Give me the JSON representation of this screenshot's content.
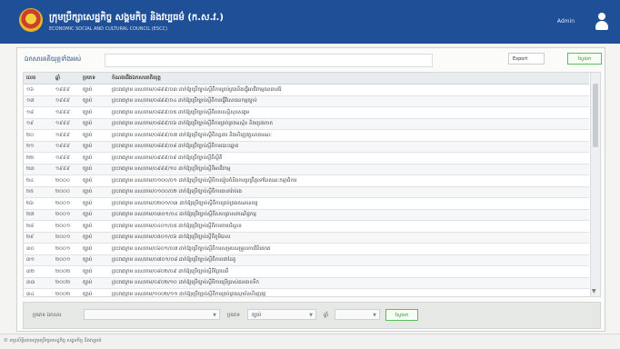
{
  "header": {
    "title": "ក្រុមប្រឹក្សាសេដ្ឋកិច្ច សង្គមកិច្ច និងវប្បធម៌ (ក.ស.វ.)",
    "subtitle": "ECONOMIC SOCIAL AND CULTURAL COUNCIL (ESCC)",
    "user_name": "Admin",
    "icons": {
      "logo": "escc-logo",
      "user": "user-icon"
    }
  },
  "panel": {
    "title": "ឯកសារគតិយុត្តទាំងអស់",
    "filter_placeholder": "",
    "export_label": "Export",
    "search_button": "ស្វែងរក"
  },
  "table": {
    "columns": [
      "លេខ",
      "ឆ្នាំ",
      "ប្រភេទ",
      "ចំណងជើងឯកសារគតិយុត្ត"
    ],
    "rows": [
      {
        "num": "១៦",
        "year": "១៩៩៩",
        "type": "ច្បាប់",
        "title": "ព្រះរាជក្រម នស/រកម/០៨៩៩/០៣ ដាក់ឱ្យប្រើច្បាប់ស្តីពីការគ្រប់គ្រងនិងធ្វើអាជីវកម្មធនធានរ៉ែ"
      },
      {
        "num": "១៧",
        "year": "១៩៩៩",
        "type": "ច្បាប់",
        "title": "ព្រះរាជក្រម នស/រកម/០៨៩៩/០៤ ដាក់ឱ្យប្រើច្បាប់ស្តីពីការធ្វើវិសោធនកម្មច្បាប់"
      },
      {
        "num": "១៨",
        "year": "១៩៩៩",
        "type": "ច្បាប់",
        "title": "ព្រះរាជក្រម នស/រកម/០៨៩៩/០៥ ដាក់ឱ្យប្រើច្បាប់ស្តីពីរបបសន្តិសុខសង្គម"
      },
      {
        "num": "១៩",
        "year": "១៩៩៩",
        "type": "ច្បាប់",
        "title": "ព្រះរាជក្រម នស/រកម/០៨៩៩/០៦ ដាក់ឱ្យប្រើច្បាប់ស្តីពីការគ្រប់គ្រងឧស្ម័ន និងប្រេងកាត"
      },
      {
        "num": "២០",
        "year": "១៩៩៩",
        "type": "ច្បាប់",
        "title": "ព្រះរាជក្រម នស/រកម/០៨៩៩/០៧ ដាក់ឱ្យប្រើច្បាប់ស្តីពីពន្ធដារ និងហិរញ្ញវត្ថុសាធារណៈ"
      },
      {
        "num": "២១",
        "year": "១៩៩៩",
        "type": "ច្បាប់",
        "title": "ព្រះរាជក្រម នស/រកម/០៨៩៩/០៨ ដាក់ឱ្យប្រើច្បាប់ស្តីពីការបោះឆ្នោត"
      },
      {
        "num": "២២",
        "year": "១៩៩៩",
        "type": "ច្បាប់",
        "title": "ព្រះរាជក្រម នស/រកម/០៩៩៩/០៩ ដាក់ឱ្យប្រើច្បាប់ស្តីពីស្ថិតិ"
      },
      {
        "num": "២៣",
        "year": "១៩៩៩",
        "type": "ច្បាប់",
        "title": "ព្រះរាជក្រម នស/រកម/០៩៩៩/១០ ដាក់ឱ្យប្រើច្បាប់ស្តីពីអាជីវកម្ម"
      },
      {
        "num": "២៤",
        "year": "២០០០",
        "type": "ច្បាប់",
        "title": "ព្រះរាជក្រម នស/រកម/០១០០/០១ ដាក់ឱ្យប្រើច្បាប់ស្តីពីការរៀបចំនិងការប្រព្រឹត្តទៅនៃគណៈកម្មាធិការ"
      },
      {
        "num": "២៥",
        "year": "២០០០",
        "type": "ច្បាប់",
        "title": "ព្រះរាជក្រម នស/រកម/០១០០/០២ ដាក់ឱ្យប្រើច្បាប់ស្តីពីការធានារ៉ាប់រង"
      },
      {
        "num": "២៦",
        "year": "២០០១",
        "type": "ច្បាប់",
        "title": "ព្រះរាជក្រម នស/រកម/០២០១/០៣ ដាក់ឱ្យប្រើច្បាប់ស្តីពីការគ្រប់គ្រងគណនេយ្យ"
      },
      {
        "num": "២៧",
        "year": "២០០១",
        "type": "ច្បាប់",
        "title": "ព្រះរាជក្រម នស/រកម/០៣០១/០៤ ដាក់ឱ្យប្រើច្បាប់ស្តីពីសហគ្រាសពាណិជ្ជកម្ម"
      },
      {
        "num": "២៨",
        "year": "២០០១",
        "type": "ច្បាប់",
        "title": "ព្រះរាជក្រម នស/រកម/០៤០១/០៥ ដាក់ឱ្យប្រើច្បាប់ស្តីពីការពារបរិស្ថាន"
      },
      {
        "num": "២៩",
        "year": "២០០១",
        "type": "ច្បាប់",
        "title": "ព្រះរាជក្រម នស/រកម/០៥០១/០៦ ដាក់ឱ្យប្រើច្បាប់ស្តីពីភូមិបាល"
      },
      {
        "num": "៣០",
        "year": "២០០១",
        "type": "ច្បាប់",
        "title": "ព្រះរាជក្រម នស/រកម/០៦០១/០៧ ដាក់ឱ្យប្រើច្បាប់ស្តីពីការសម្របសម្រួលការវិនិយោគ"
      },
      {
        "num": "៣១",
        "year": "២០០១",
        "type": "ច្បាប់",
        "title": "ព្រះរាជក្រម នស/រកម/០៧០១/០៨ ដាក់ឱ្យប្រើច្បាប់ស្តីពីភាពជាដៃគូ"
      },
      {
        "num": "៣២",
        "year": "២០០២",
        "type": "ច្បាប់",
        "title": "ព្រះរាជក្រម នស/រកម/០៨០២/០៩ ដាក់ឱ្យប្រើច្បាប់ស្តីពីព្រៃឈើ"
      },
      {
        "num": "៣៣",
        "year": "២០០២",
        "type": "ច្បាប់",
        "title": "ព្រះរាជក្រម នស/រកម/០៩០២/១០ ដាក់ឱ្យប្រើច្បាប់ស្តីពីការប្រើប្រាស់ធនធានទឹក"
      },
      {
        "num": "៣៤",
        "year": "២០០២",
        "type": "ច្បាប់",
        "title": "ព្រះរាជក្រម នស/រកម/១០០២/១១ ដាក់ឱ្យប្រើច្បាប់ស្តីពីការគ្រប់គ្រងស្ថាប័នហិរញ្ញវត្ថុ"
      },
      {
        "num": "៣៥",
        "year": "២០០២",
        "type": "ច្បាប់",
        "title": "ព្រះរាជក្រម នស/រកម/១១០២/១២ ដាក់ឱ្យប្រើច្បាប់ស្តីពីវិធានពន្ធដារ"
      }
    ]
  },
  "bottom_bar": {
    "type_label": "ប្រភេទ ឯកសារ",
    "type_value": "",
    "category_label": "ប្រភេទ",
    "category_value": "ច្បាប់",
    "year_label": "ឆ្នាំ",
    "year_value": "",
    "submit_label": "ស្វែងរក"
  },
  "footer": {
    "text": "© រក្សាសិទ្ធិដោយក្រុមប្រឹក្សាសេដ្ឋកិច្ច សង្គមកិច្ច និងវប្បធម៌"
  },
  "colors": {
    "header_bg": "#1f4f97",
    "accent_green": "#5bbd5b"
  }
}
